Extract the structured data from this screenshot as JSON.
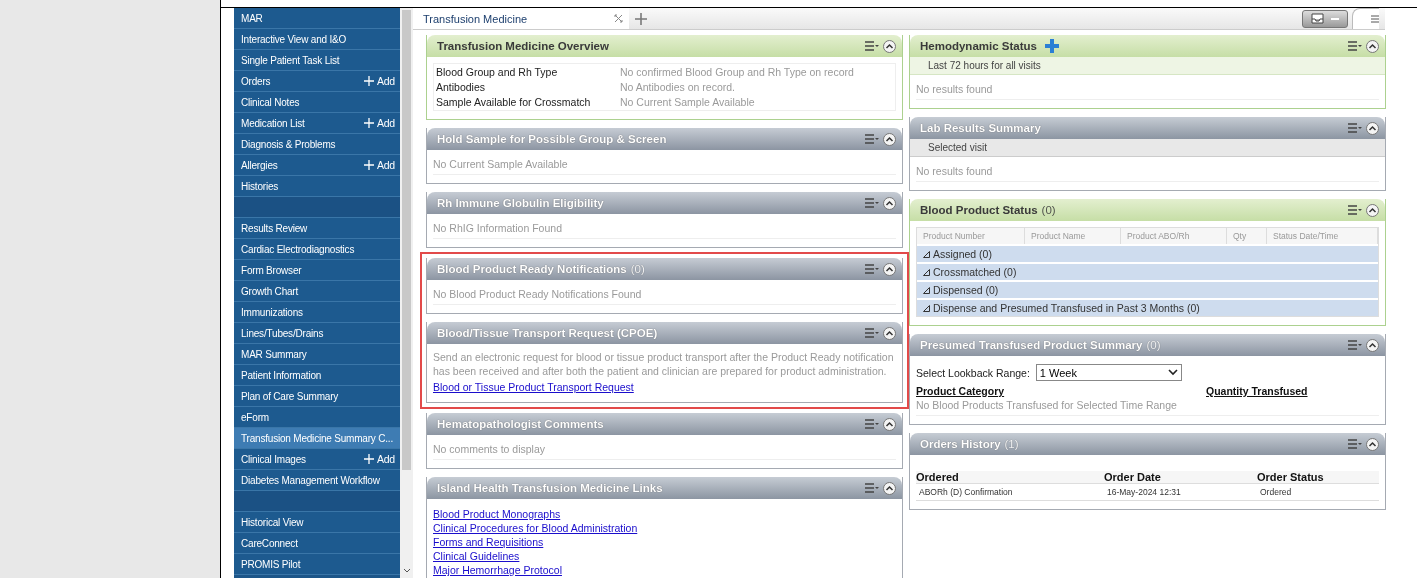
{
  "sidebar": {
    "items": [
      {
        "label": "MAR",
        "selected": false
      },
      {
        "label": "Interactive View and I&O",
        "selected": false
      },
      {
        "label": "Single Patient Task List",
        "selected": false
      },
      {
        "label": "Orders",
        "selected": false,
        "action": "Add"
      },
      {
        "label": "Clinical Notes",
        "selected": false
      },
      {
        "label": "Medication List",
        "selected": false,
        "action": "Add"
      },
      {
        "label": "Diagnosis & Problems",
        "selected": false
      },
      {
        "label": "Allergies",
        "selected": false,
        "action": "Add"
      },
      {
        "label": "Histories",
        "selected": false
      },
      {
        "kind": "spacer"
      },
      {
        "label": "Results Review",
        "selected": false
      },
      {
        "label": "Cardiac Electrodiagnostics",
        "selected": false
      },
      {
        "label": "Form Browser",
        "selected": false
      },
      {
        "label": "Growth Chart",
        "selected": false
      },
      {
        "label": "Immunizations",
        "selected": false
      },
      {
        "label": "Lines/Tubes/Drains",
        "selected": false
      },
      {
        "label": "MAR Summary",
        "selected": false
      },
      {
        "label": "Patient Information",
        "selected": false
      },
      {
        "label": "Plan of Care Summary",
        "selected": false
      },
      {
        "label": "eForm",
        "selected": false
      },
      {
        "label": "Transfusion Medicine Summary C...",
        "selected": true
      },
      {
        "label": "Clinical Images",
        "selected": false,
        "action": "Add"
      },
      {
        "label": "Diabetes Management Workflow",
        "selected": false
      },
      {
        "kind": "spacer"
      },
      {
        "label": "Historical View",
        "selected": false
      },
      {
        "label": "CareConnect",
        "selected": false
      },
      {
        "label": "PROMIS Pilot",
        "selected": false
      }
    ]
  },
  "tabs": [
    {
      "label": "Transfusion Medicine",
      "selected": true
    }
  ],
  "left_panels": [
    {
      "title": "Transfusion Medicine Overview",
      "kind": "summary",
      "highlighted": false,
      "rows": [
        {
          "label": "Blood Group and Rh Type",
          "value": "No confirmed Blood Group and Rh Type on record"
        },
        {
          "label": "Antibodies",
          "value": "No Antibodies on record."
        },
        {
          "label": "Sample Available for Crossmatch",
          "value": "No Current Sample Available"
        }
      ]
    },
    {
      "title": "Hold Sample for Possible Group & Screen",
      "kind": "section",
      "highlighted": false,
      "message": "No Current Sample Available"
    },
    {
      "title": "Rh Immune Globulin Eligibility",
      "kind": "section",
      "highlighted": false,
      "message": "No RhIG Information Found"
    },
    {
      "title": "Blood Product Ready Notifications",
      "count": "(0)",
      "kind": "section",
      "highlighted": true,
      "message": "No Blood Product Ready Notifications Found"
    },
    {
      "title": "Blood/Tissue Transport Request (CPOE)",
      "kind": "section",
      "highlighted": true,
      "text": "Send an electronic request for blood or tissue product transport after the Product Ready notification has been received and after both the patient and clinician are prepared for product administration.",
      "link": "Blood or Tissue Product Transport Request"
    },
    {
      "title": "Hematopathologist Comments",
      "kind": "section",
      "highlighted": false,
      "message": "No comments to display"
    },
    {
      "title": "Island Health Transfusion Medicine Links",
      "kind": "section",
      "highlighted": false,
      "links": [
        "Blood Product Monographs",
        "Clinical Procedures for Blood Administration",
        "Forms and Requisitions",
        "Clinical Guidelines",
        "Major Hemorrhage Protocol"
      ]
    }
  ],
  "right_panels": [
    {
      "title": "Hemodynamic Status",
      "kind": "summary",
      "add_button": true,
      "subheader": "Last 72 hours for all visits",
      "message": "No results found"
    },
    {
      "title": "Lab Results Summary",
      "kind": "section",
      "subheader": "Selected visit",
      "message": "No results found"
    },
    {
      "title": "Blood Product Status",
      "count": "(0)",
      "kind": "summary",
      "columns": [
        "Product Number",
        "Product Name",
        "Product ABO/Rh",
        "Qty",
        "Status Date/Time"
      ],
      "groups": [
        {
          "label": "Assigned (0)",
          "expanded": false
        },
        {
          "label": "Crossmatched (0)",
          "expanded": false
        },
        {
          "label": "Dispensed (0)",
          "expanded": false
        },
        {
          "label": "Dispense and Presumed Transfused in Past 3 Months (0)",
          "expanded": false
        }
      ]
    },
    {
      "title": "Presumed Transfused Product Summary",
      "count": "(0)",
      "kind": "section",
      "select_label": "Select Lookback Range:",
      "select_value": "1 Week",
      "columns": [
        "Product Category",
        "Quantity Transfused"
      ],
      "message": "No Blood Products Transfused for Selected Time Range"
    },
    {
      "title": "Orders History",
      "count": "(1)",
      "kind": "section",
      "columns": [
        "Ordered",
        "Order Date",
        "Order Status"
      ],
      "rows": [
        [
          "ABORh (D) Confirmation",
          "16-May-2024 12:31",
          "Ordered"
        ]
      ]
    }
  ]
}
